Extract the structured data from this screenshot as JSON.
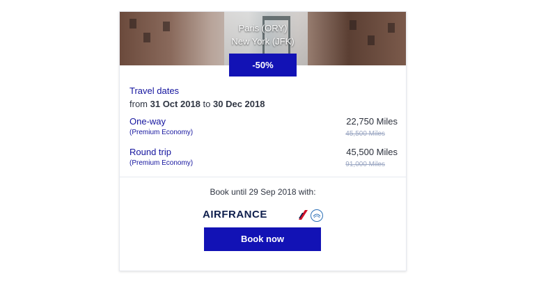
{
  "hero": {
    "origin": "Paris (ORY)",
    "destination": "New York (JFK)",
    "discount_badge": "-50%"
  },
  "travel_dates": {
    "heading": "Travel dates",
    "from_word": "from",
    "start": "31 Oct 2018",
    "to_word": "to",
    "end": "30 Dec 2018"
  },
  "fares": [
    {
      "type": "One-way",
      "cabin": "(Premium Economy)",
      "price": "22,750 Miles",
      "original_price": "45,500 Miles"
    },
    {
      "type": "Round trip",
      "cabin": "(Premium Economy)",
      "price": "45,500 Miles",
      "original_price": "91,000 Miles"
    }
  ],
  "booking": {
    "until_text": "Book until 29 Sep 2018 with:",
    "airline_logo_text": "AIRFRANCE",
    "button_label": "Book now"
  },
  "colors": {
    "accent": "#1212b5",
    "label_blue": "#14149e",
    "text_dark": "#2a2f3a",
    "strikethrough": "#9aa6c2"
  },
  "icons": [
    "airfrance-stripe-icon",
    "skyteam-seal-icon"
  ]
}
